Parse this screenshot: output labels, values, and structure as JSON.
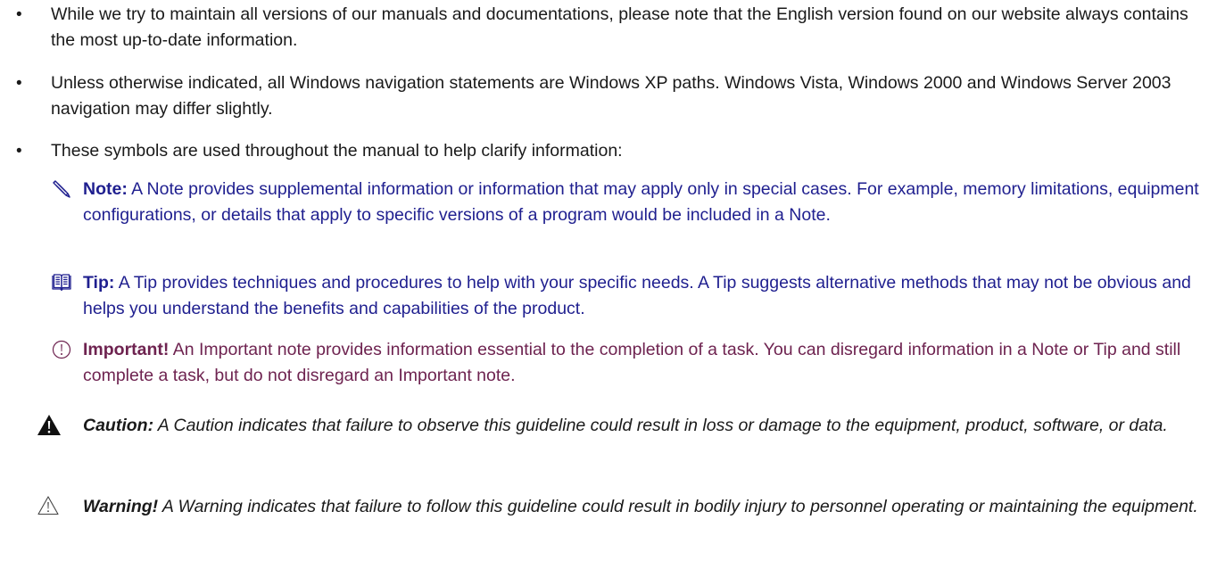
{
  "bullets": [
    {
      "marker": "•",
      "text": "While we try to maintain all versions of our manuals and documentations, please note that the English version found on our website always contains the most up-to-date information."
    },
    {
      "marker": "•",
      "text": "Unless otherwise indicated, all Windows navigation statements are Windows XP paths. Windows Vista, Windows 2000 and Windows Server 2003 navigation may differ slightly."
    },
    {
      "marker": "•",
      "text": "These symbols are used throughout the manual to help clarify information:"
    }
  ],
  "callouts": {
    "note": {
      "icon": "pencil-icon",
      "label": "Note:",
      "text": "A Note provides supplemental information or information that may apply only in special cases. For example, memory limitations, equipment configurations, or details that apply to specific versions of a program would be included in a Note.",
      "color": "#1f1f8f"
    },
    "tip": {
      "icon": "open-book-icon",
      "label": "Tip:",
      "text": "A Tip provides techniques and procedures to help with your specific needs. A Tip suggests alternative methods that may not be obvious and helps you understand the benefits and capabilities of the product.",
      "color": "#1f1f8f"
    },
    "important": {
      "icon": "exclamation-circle-icon",
      "label": "Important!",
      "text": "An Important note provides information essential to the completion of a task. You can disregard information in a Note or Tip and still complete a task, but do not disregard an Important note.",
      "color": "#6e2350"
    },
    "caution": {
      "icon": "filled-warning-triangle-icon",
      "label": "Caution:",
      "text": "A Caution indicates that failure to observe this guideline could result in loss or damage to the equipment, product, software, or data.",
      "color": "#1a1a1a"
    },
    "warning": {
      "icon": "outline-warning-triangle-icon",
      "label": "Warning!",
      "text": "A Warning indicates that failure to follow this guideline could result in bodily injury to personnel operating or maintaining the equipment.",
      "color": "#1a1a1a"
    }
  }
}
